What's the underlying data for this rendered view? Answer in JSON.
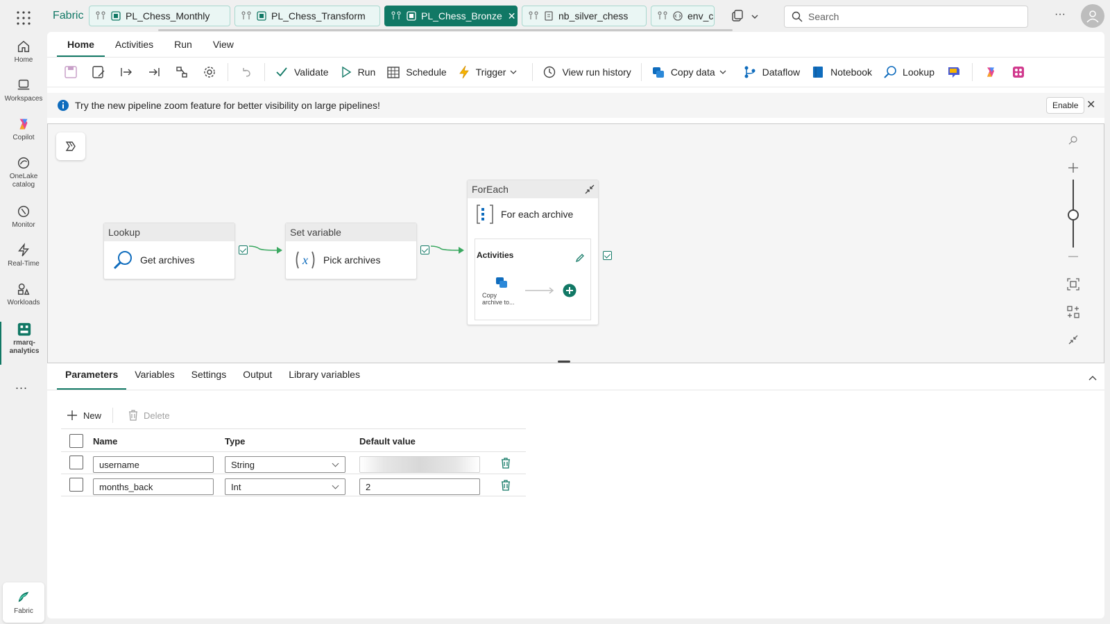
{
  "rail": {
    "items": [
      {
        "label": "Home",
        "icon": "home-icon"
      },
      {
        "label": "Workspaces",
        "icon": "workspaces-icon"
      },
      {
        "label": "Copilot",
        "icon": "copilot-icon"
      },
      {
        "label": "OneLake catalog",
        "icon": "onelake-icon"
      },
      {
        "label": "Monitor",
        "icon": "monitor-icon"
      },
      {
        "label": "Real-Time",
        "icon": "realtime-icon"
      },
      {
        "label": "Workloads",
        "icon": "workloads-icon"
      },
      {
        "label": "rmarq-analytics",
        "icon": "workspace-icon"
      }
    ],
    "more": "...",
    "fabric_label": "Fabric"
  },
  "topbar": {
    "brand": "Fabric",
    "tabs": [
      {
        "label": "PL_Chess_Monthly"
      },
      {
        "label": "PL_Chess_Transform"
      },
      {
        "label": "PL_Chess_Bronze"
      },
      {
        "label": "nb_silver_chess"
      },
      {
        "label": "env_c"
      }
    ],
    "search_placeholder": "Search",
    "more": "···"
  },
  "menu": {
    "tabs": [
      "Home",
      "Activities",
      "Run",
      "View"
    ]
  },
  "toolbar": {
    "validate": "Validate",
    "run": "Run",
    "schedule": "Schedule",
    "trigger": "Trigger",
    "view_run_history": "View run history",
    "copy_data": "Copy data",
    "dataflow": "Dataflow",
    "notebook": "Notebook",
    "lookup": "Lookup"
  },
  "infobar": {
    "text": "Try the new pipeline zoom feature for better visibility on large pipelines!",
    "enable": "Enable"
  },
  "canvas": {
    "lookup": {
      "type": "Lookup",
      "name": "Get archives"
    },
    "setvar": {
      "type": "Set variable",
      "name": "Pick archives"
    },
    "foreach": {
      "type": "ForEach",
      "name": "For each archive",
      "activities_label": "Activities",
      "inner_activity": "Copy archive to..."
    }
  },
  "bottom": {
    "tabs": [
      "Parameters",
      "Variables",
      "Settings",
      "Output",
      "Library variables"
    ],
    "new": "New",
    "delete": "Delete",
    "headers": {
      "name": "Name",
      "type": "Type",
      "default": "Default value"
    },
    "params": [
      {
        "name": "username",
        "type": "String",
        "default": ""
      },
      {
        "name": "months_back",
        "type": "Int",
        "default": "2"
      }
    ]
  },
  "colors": {
    "accent": "#117865",
    "link": "#0f6cbd"
  }
}
